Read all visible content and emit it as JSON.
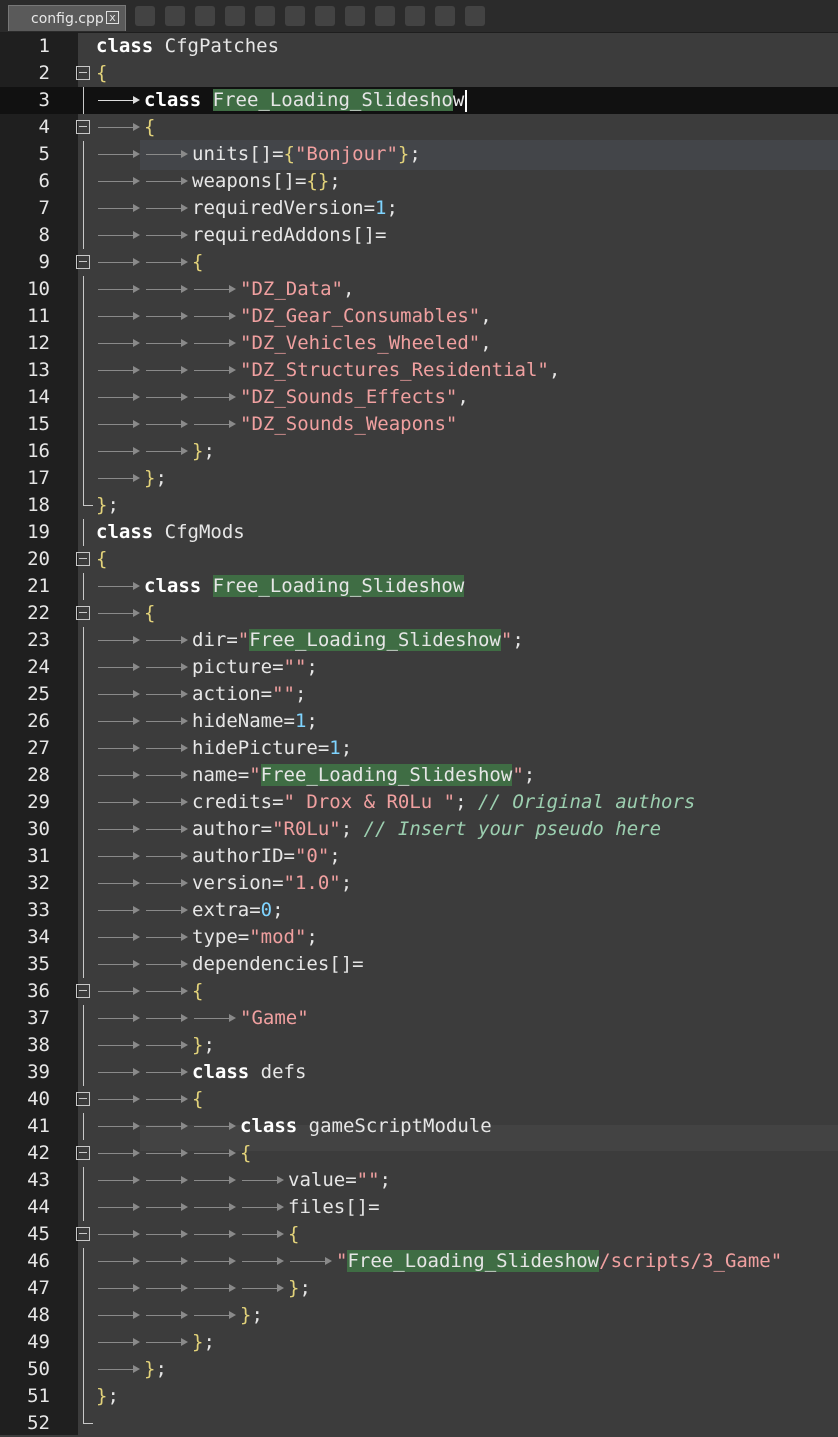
{
  "tab": {
    "title": "config.cpp",
    "close": "x"
  },
  "editor": {
    "current_line": 3,
    "lines": [
      [
        [
          "kw",
          "class"
        ],
        [
          "ws",
          " "
        ],
        [
          "t",
          "CfgPatches"
        ]
      ],
      [
        [
          "br",
          "{"
        ]
      ],
      [
        [
          "i",
          1
        ],
        [
          "kw",
          "class"
        ],
        [
          "ws",
          " "
        ],
        [
          "hl",
          "Free_Loading_Slidesho"
        ],
        [
          "t",
          "w"
        ],
        [
          "caret",
          ""
        ]
      ],
      [
        [
          "i",
          1
        ],
        [
          "br",
          "{"
        ]
      ],
      [
        [
          "i",
          2
        ],
        [
          "t",
          "units[]="
        ],
        [
          "br",
          "{"
        ],
        [
          "str",
          "\"Bonjour\""
        ],
        [
          "br",
          "}"
        ],
        [
          "t",
          ";"
        ]
      ],
      [
        [
          "i",
          2
        ],
        [
          "t",
          "weapons[]="
        ],
        [
          "br",
          "{}"
        ],
        [
          "t",
          ";"
        ]
      ],
      [
        [
          "i",
          2
        ],
        [
          "t",
          "requiredVersion="
        ],
        [
          "num",
          "1"
        ],
        [
          "t",
          ";"
        ]
      ],
      [
        [
          "i",
          2
        ],
        [
          "t",
          "requiredAddons[]="
        ]
      ],
      [
        [
          "i",
          2
        ],
        [
          "br",
          "{"
        ]
      ],
      [
        [
          "i",
          3
        ],
        [
          "str",
          "\"DZ_Data\""
        ],
        [
          "t",
          ","
        ]
      ],
      [
        [
          "i",
          3
        ],
        [
          "str",
          "\"DZ_Gear_Consumables\""
        ],
        [
          "t",
          ","
        ]
      ],
      [
        [
          "i",
          3
        ],
        [
          "str",
          "\"DZ_Vehicles_Wheeled\""
        ],
        [
          "t",
          ","
        ]
      ],
      [
        [
          "i",
          3
        ],
        [
          "str",
          "\"DZ_Structures_Residential\""
        ],
        [
          "t",
          ","
        ]
      ],
      [
        [
          "i",
          3
        ],
        [
          "str",
          "\"DZ_Sounds_Effects\""
        ],
        [
          "t",
          ","
        ]
      ],
      [
        [
          "i",
          3
        ],
        [
          "str",
          "\"DZ_Sounds_Weapons\""
        ]
      ],
      [
        [
          "i",
          2
        ],
        [
          "br",
          "}"
        ],
        [
          "t",
          ";"
        ]
      ],
      [
        [
          "i",
          1
        ],
        [
          "br",
          "}"
        ],
        [
          "t",
          ";"
        ]
      ],
      [
        [
          "br",
          "}"
        ],
        [
          "t",
          ";"
        ]
      ],
      [
        [
          "kw",
          "class"
        ],
        [
          "ws",
          " "
        ],
        [
          "t",
          "CfgMods"
        ]
      ],
      [
        [
          "br",
          "{"
        ]
      ],
      [
        [
          "i",
          1
        ],
        [
          "kw",
          "class"
        ],
        [
          "ws",
          " "
        ],
        [
          "hl",
          "Free_Loading_Slideshow"
        ]
      ],
      [
        [
          "i",
          1
        ],
        [
          "br",
          "{"
        ]
      ],
      [
        [
          "i",
          2
        ],
        [
          "t",
          "dir="
        ],
        [
          "str",
          "\""
        ],
        [
          "hl",
          "Free_Loading_Slideshow"
        ],
        [
          "str",
          "\""
        ],
        [
          "t",
          ";"
        ]
      ],
      [
        [
          "i",
          2
        ],
        [
          "t",
          "picture="
        ],
        [
          "str",
          "\"\""
        ],
        [
          "t",
          ";"
        ]
      ],
      [
        [
          "i",
          2
        ],
        [
          "t",
          "action="
        ],
        [
          "str",
          "\"\""
        ],
        [
          "t",
          ";"
        ]
      ],
      [
        [
          "i",
          2
        ],
        [
          "t",
          "hideName="
        ],
        [
          "num",
          "1"
        ],
        [
          "t",
          ";"
        ]
      ],
      [
        [
          "i",
          2
        ],
        [
          "t",
          "hidePicture="
        ],
        [
          "num",
          "1"
        ],
        [
          "t",
          ";"
        ]
      ],
      [
        [
          "i",
          2
        ],
        [
          "t",
          "name="
        ],
        [
          "str",
          "\""
        ],
        [
          "hl",
          "Free_Loading_Slideshow"
        ],
        [
          "str",
          "\""
        ],
        [
          "t",
          ";"
        ]
      ],
      [
        [
          "i",
          2
        ],
        [
          "t",
          "credits="
        ],
        [
          "str",
          "\" Drox & R0Lu \""
        ],
        [
          "t",
          "; "
        ],
        [
          "cmt",
          "// Original authors"
        ]
      ],
      [
        [
          "i",
          2
        ],
        [
          "t",
          "author="
        ],
        [
          "str",
          "\"R0Lu\""
        ],
        [
          "t",
          "; "
        ],
        [
          "cmt",
          "// Insert your pseudo here"
        ]
      ],
      [
        [
          "i",
          2
        ],
        [
          "t",
          "authorID="
        ],
        [
          "str",
          "\"0\""
        ],
        [
          "t",
          ";"
        ]
      ],
      [
        [
          "i",
          2
        ],
        [
          "t",
          "version="
        ],
        [
          "str",
          "\"1.0\""
        ],
        [
          "t",
          ";"
        ]
      ],
      [
        [
          "i",
          2
        ],
        [
          "t",
          "extra="
        ],
        [
          "num",
          "0"
        ],
        [
          "t",
          ";"
        ]
      ],
      [
        [
          "i",
          2
        ],
        [
          "t",
          "type="
        ],
        [
          "str",
          "\"mod\""
        ],
        [
          "t",
          ";"
        ]
      ],
      [
        [
          "i",
          2
        ],
        [
          "t",
          "dependencies[]="
        ]
      ],
      [
        [
          "i",
          2
        ],
        [
          "br",
          "{"
        ]
      ],
      [
        [
          "i",
          3
        ],
        [
          "str",
          "\"Game\""
        ]
      ],
      [
        [
          "i",
          2
        ],
        [
          "br",
          "}"
        ],
        [
          "t",
          ";"
        ]
      ],
      [
        [
          "i",
          2
        ],
        [
          "kw",
          "class"
        ],
        [
          "ws",
          " "
        ],
        [
          "t",
          "defs"
        ]
      ],
      [
        [
          "i",
          2
        ],
        [
          "br",
          "{"
        ]
      ],
      [
        [
          "i",
          3
        ],
        [
          "kw",
          "class"
        ],
        [
          "ws",
          " "
        ],
        [
          "t",
          "gameScriptModule"
        ]
      ],
      [
        [
          "i",
          3
        ],
        [
          "br",
          "{"
        ]
      ],
      [
        [
          "i",
          4
        ],
        [
          "t",
          "value="
        ],
        [
          "str",
          "\"\""
        ],
        [
          "t",
          ";"
        ]
      ],
      [
        [
          "i",
          4
        ],
        [
          "t",
          "files[]="
        ]
      ],
      [
        [
          "i",
          4
        ],
        [
          "br",
          "{"
        ]
      ],
      [
        [
          "i",
          5
        ],
        [
          "str",
          "\""
        ],
        [
          "hl",
          "Free_Loading_Slideshow"
        ],
        [
          "str",
          "/scripts/3_Game\""
        ]
      ],
      [
        [
          "i",
          4
        ],
        [
          "br",
          "}"
        ],
        [
          "t",
          ";"
        ]
      ],
      [
        [
          "i",
          3
        ],
        [
          "br",
          "}"
        ],
        [
          "t",
          ";"
        ]
      ],
      [
        [
          "i",
          2
        ],
        [
          "br",
          "}"
        ],
        [
          "t",
          ";"
        ]
      ],
      [
        [
          "i",
          1
        ],
        [
          "br",
          "}"
        ],
        [
          "t",
          ";"
        ]
      ],
      [
        [
          "br",
          "}"
        ],
        [
          "t",
          ";"
        ]
      ],
      []
    ],
    "fold_lines": [
      2,
      4,
      9,
      20,
      22,
      36,
      40,
      42,
      45
    ],
    "fold_end_lines": [
      18,
      52
    ],
    "guide_lines": [
      3,
      5,
      6,
      7,
      8,
      10,
      11,
      12,
      13,
      14,
      15,
      16,
      17,
      19,
      21,
      23,
      24,
      25,
      26,
      27,
      28,
      29,
      30,
      31,
      32,
      33,
      34,
      35,
      37,
      38,
      39,
      41,
      43,
      44,
      46,
      47,
      48,
      49,
      50,
      51
    ]
  }
}
